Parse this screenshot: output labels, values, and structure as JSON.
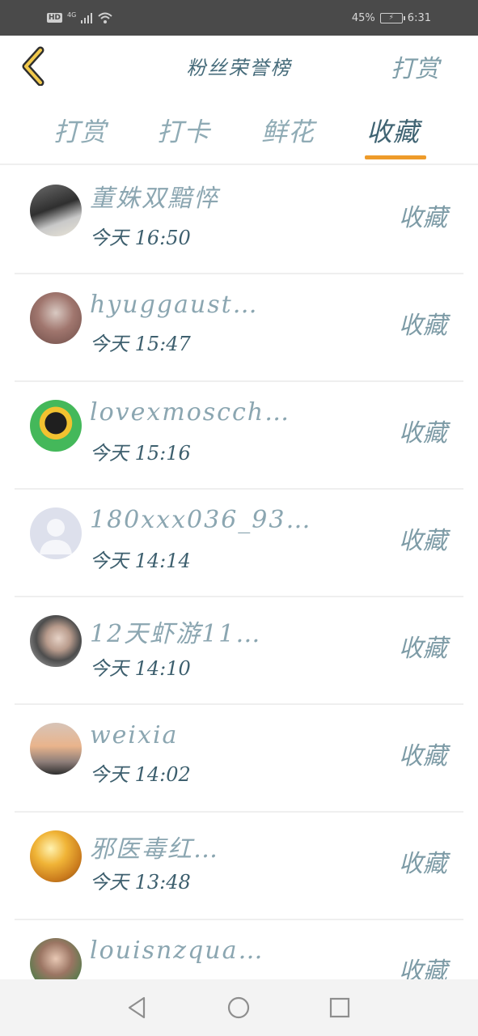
{
  "status_bar": {
    "hd": "HD",
    "network": "4G",
    "battery_percent": "45%",
    "time": "6:31"
  },
  "header": {
    "title": "粉丝荣誉榜",
    "right_link": "打赏",
    "back_icon": "chevron-left-icon"
  },
  "tabs": [
    {
      "label": "打赏",
      "active": false
    },
    {
      "label": "打卡",
      "active": false
    },
    {
      "label": "鲜花",
      "active": false
    },
    {
      "label": "收藏",
      "active": true
    }
  ],
  "colors": {
    "accent": "#ee9b2a",
    "text_primary": "#3f6372",
    "text_muted": "#8ba6b1",
    "divider": "#efefef"
  },
  "list": [
    {
      "name": "董姝双黯悴",
      "time": "今天 16:50",
      "action": "收藏"
    },
    {
      "name": "hyuggaust…",
      "time": "今天 15:47",
      "action": "收藏"
    },
    {
      "name": "lovexmoscch…",
      "time": "今天 15:16",
      "action": "收藏"
    },
    {
      "name": "180xxx036_93…",
      "time": "今天 14:14",
      "action": "收藏"
    },
    {
      "name": "12天虾游11…",
      "time": "今天 14:10",
      "action": "收藏"
    },
    {
      "name": "weixia",
      "time": "今天 14:02",
      "action": "收藏"
    },
    {
      "name": "邪医毒红…",
      "time": "今天 13:48",
      "action": "收藏"
    },
    {
      "name": "louisnzqua…",
      "time": "",
      "action": "收藏"
    }
  ],
  "nav_bar": {
    "back_icon": "triangle-back-icon",
    "home_icon": "circle-home-icon",
    "recent_icon": "square-recent-icon"
  }
}
